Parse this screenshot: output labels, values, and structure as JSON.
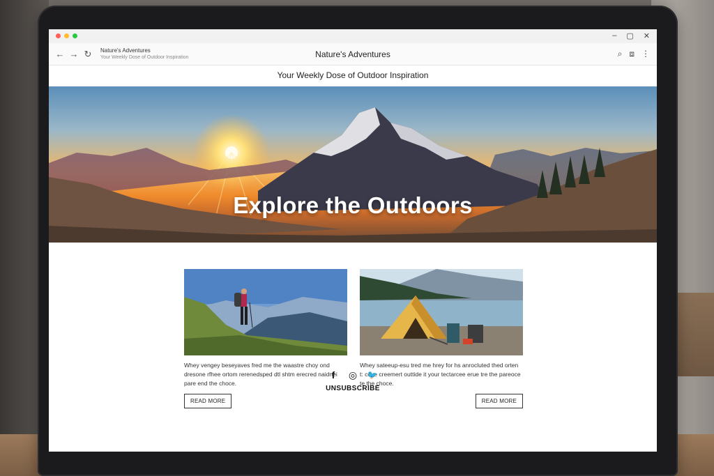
{
  "browser": {
    "tab_title": "Nature's Adventures",
    "tab_subtitle": "Your Weekly Dose of Outdoor Inspiration",
    "page_title": "Nature's Adventures",
    "back_icon": "←",
    "forward_icon": "→",
    "reload_icon": "↻",
    "search_icon": "⌕",
    "extensions_icon": "⧈",
    "menu_icon": "⋮",
    "minimize_icon": "–",
    "maximize_icon": "▢",
    "close_icon": "✕",
    "dot_colors": [
      "#ff5f57",
      "#febc2e",
      "#28c840"
    ]
  },
  "header": {
    "tagline": "Your Weekly Dose of Outdoor Inspiration"
  },
  "hero": {
    "title": "Explore the Outdoors"
  },
  "cards": [
    {
      "text": "Whey vengey beseyaves fred me the waastre choy ond dresone rfhee ortom rerenedsped dtl shtm erecred naidnei pare end the choce.",
      "button": "READ MORE"
    },
    {
      "text": "Whey sateeup-esu tred me hrey for hs anrocluted thed orten t: coxe creemert outtide it your tectarcee erue tre the pareoce te the choce.",
      "button": "READ MORE"
    }
  ],
  "footer": {
    "facebook_icon": "f",
    "instagram_icon": "◎",
    "twitter_icon": "🐦",
    "unsubscribe": "UNSUBSCRIBE"
  }
}
